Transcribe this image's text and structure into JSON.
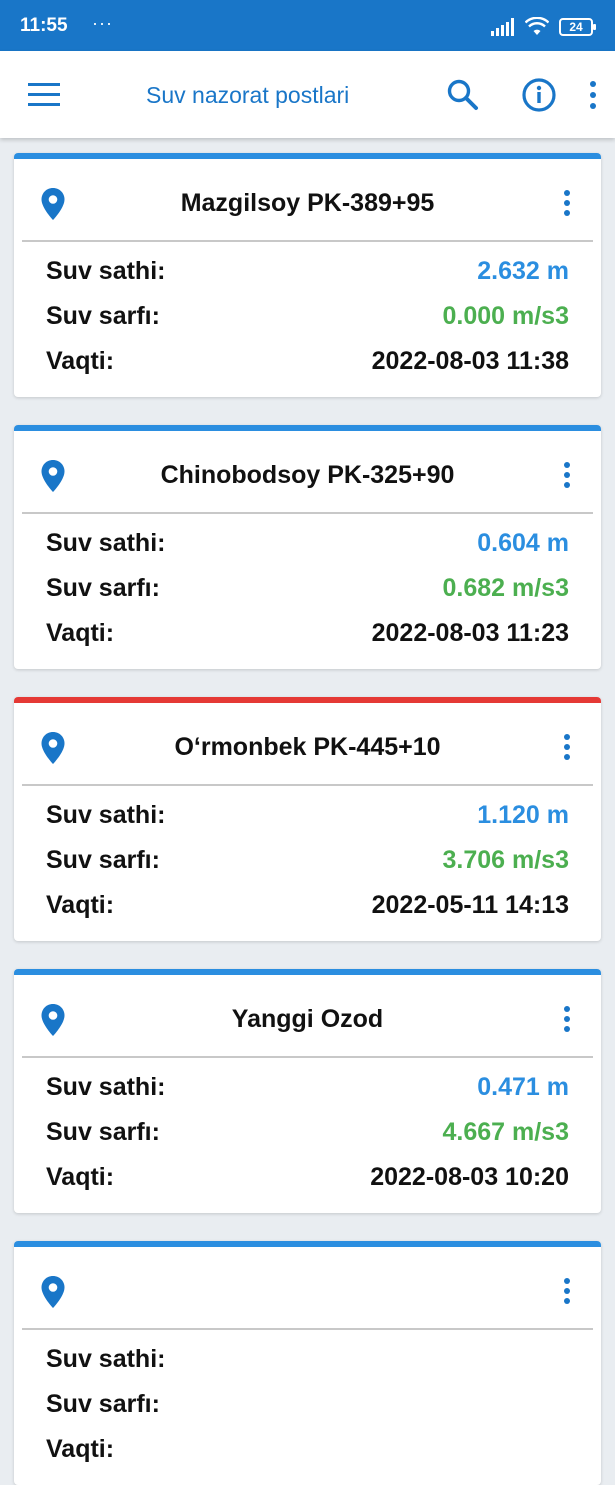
{
  "status_bar": {
    "time": "11:55",
    "dots": "···",
    "battery": "24"
  },
  "app_bar": {
    "title": "Suv nazorat postlari"
  },
  "colors": {
    "primary": "#1976c8",
    "level": "#2b8ee0",
    "flow": "#4caf50",
    "alert": "#e53935"
  },
  "labels": {
    "level": "Suv sathi:",
    "flow": "Suv sarfı:",
    "time": "Vaqti:"
  },
  "cards": [
    {
      "name": "Mazgilsoy PK-389+95",
      "level": "2.632 m",
      "flow": "0.000 m/s3",
      "time": "2022-08-03 11:38",
      "status_color": "#2b8ee0"
    },
    {
      "name": "Chinobodsoy PK-325+90",
      "level": "0.604 m",
      "flow": "0.682 m/s3",
      "time": "2022-08-03 11:23",
      "status_color": "#2b8ee0"
    },
    {
      "name": "O‘rmonbek PK-445+10",
      "level": "1.120 m",
      "flow": "3.706 m/s3",
      "time": "2022-05-11 14:13",
      "status_color": "#e53935"
    },
    {
      "name": "Yanggi Ozod",
      "level": "0.471 m",
      "flow": "4.667 m/s3",
      "time": "2022-08-03 10:20",
      "status_color": "#2b8ee0"
    },
    {
      "name": "",
      "level": "",
      "flow": "",
      "time": "",
      "status_color": "#2b8ee0"
    }
  ]
}
